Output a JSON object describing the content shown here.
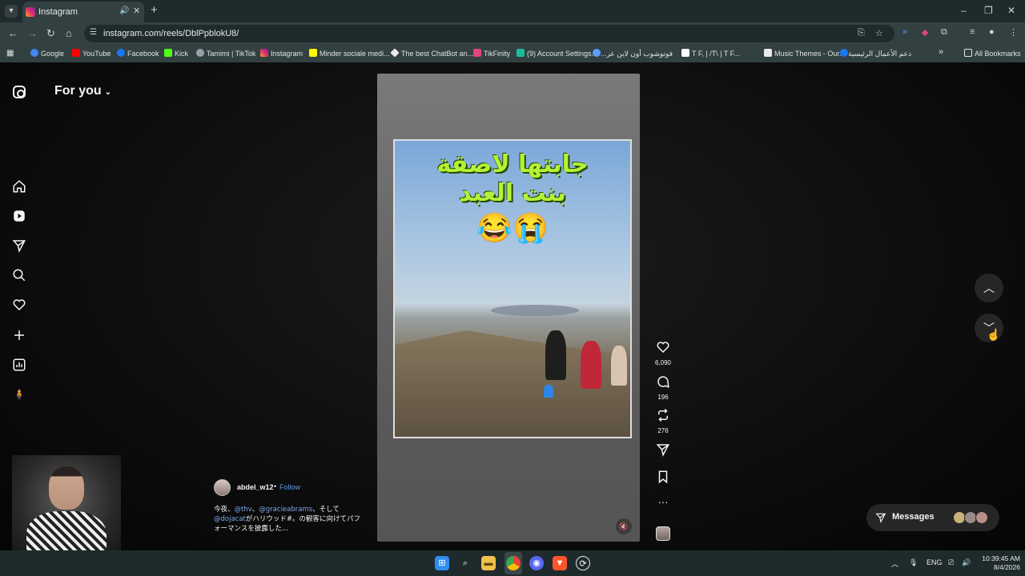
{
  "browser": {
    "tab_title": "Instagram",
    "url": "instagram.com/reels/DblPpblokU8/",
    "bookmarks": [
      "Google",
      "YouTube",
      "Facebook",
      "Kick",
      "Tamimi | TikTok",
      "Instagram",
      "Minder sociale medi...",
      "The best ChatBot an...",
      "TikFinity",
      "(9) Account Settings...",
      "فوتوشوب أون لاين عر...",
      "T F, | /T\\ | T F...",
      "Music Themes - Our...",
      "دعم الأعمال الرئيسية"
    ],
    "all_bookmarks": "All Bookmarks"
  },
  "instagram": {
    "feed_label": "For you",
    "reel": {
      "caption_line1": "جابتها لاصقة",
      "caption_line2": "بنت العبد",
      "caption_emoji": "😂😭"
    },
    "actions": {
      "likes": "6,090",
      "comments": "196",
      "reposts": "276"
    },
    "author": {
      "username": "abdel_w12",
      "separator": "•",
      "follow_label": "Follow"
    },
    "description": {
      "part1": "今夜、",
      "mention1": "@thv",
      "part2": "、",
      "mention2": "@gracieabrams",
      "part3": "、そして",
      "mention3": "@dojacat",
      "part4": "がハリウッド#。の観客に向けてパフォーマンスを披露した..."
    },
    "messages_label": "Messages"
  },
  "taskbar": {
    "language": "ENG",
    "time": "10:39:45 AM",
    "date": "8/4/2026"
  },
  "colors": {
    "follow_link": "#5f9ee8",
    "caption_green": "#b4f236",
    "chrome_bg": "#334042"
  }
}
